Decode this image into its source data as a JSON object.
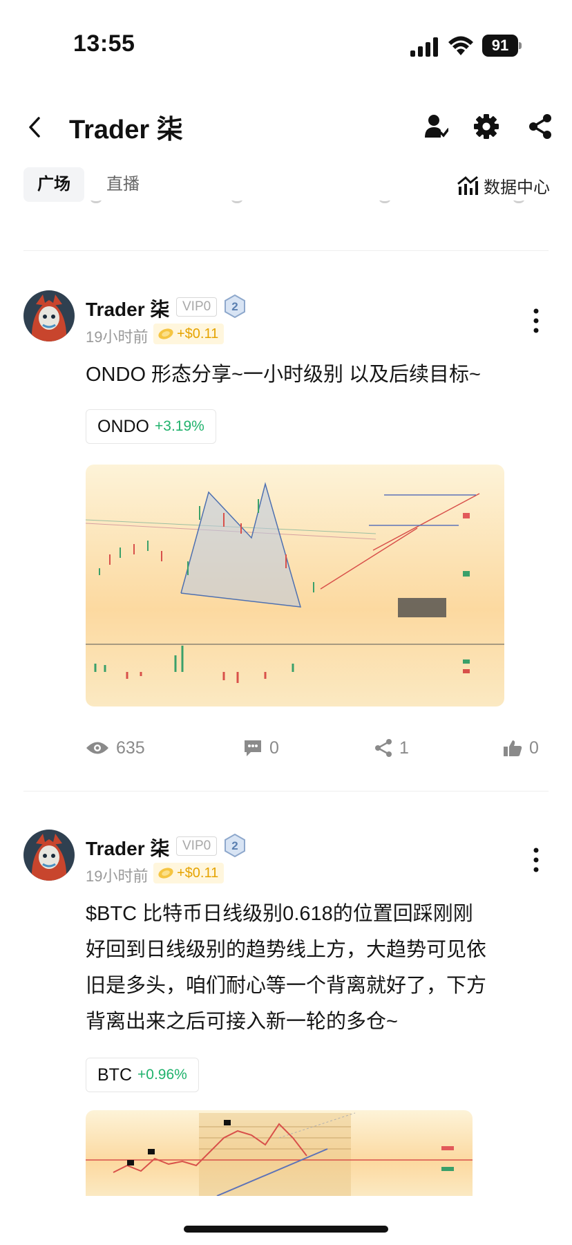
{
  "status_bar": {
    "time": "13:55",
    "battery": "91"
  },
  "header": {
    "title": "Trader 柒"
  },
  "tabs": [
    {
      "label": "广场",
      "active": true
    },
    {
      "label": "直播",
      "active": false
    }
  ],
  "data_center": {
    "label": "数据中心"
  },
  "posts": [
    {
      "author": "Trader 柒",
      "vip": "VIP0",
      "level": "2",
      "time": "19小时前",
      "tip": "+$0.11",
      "text_lines": [
        "ONDO 形态分享~一小时级别 以及后续目标~"
      ],
      "coin": {
        "symbol": "ONDO",
        "change": "+3.19%"
      },
      "stats": {
        "views": "635",
        "comments": "0",
        "shares": "1",
        "likes": "0"
      }
    },
    {
      "author": "Trader 柒",
      "vip": "VIP0",
      "level": "2",
      "time": "19小时前",
      "tip": "+$0.11",
      "text_lines": [
        "$BTC 比特币日线级别0.618的位置回踩刚刚",
        "好回到日线级别的趋势线上方，大趋势可见依",
        "旧是多头，咱们耐心等一个背离就好了，下方",
        "背离出来之后可接入新一轮的多仓~"
      ],
      "coin": {
        "symbol": "BTC",
        "change": "+0.96%"
      }
    }
  ],
  "colors": {
    "up": "#20b26c",
    "tip": "#e5a300",
    "accent": "#111111"
  },
  "icons": [
    "back-icon",
    "follow-user-icon",
    "gear-icon",
    "share-icon",
    "chart-icon",
    "eye-icon",
    "comment-icon",
    "like-icon",
    "more-icon",
    "coin-icon"
  ]
}
